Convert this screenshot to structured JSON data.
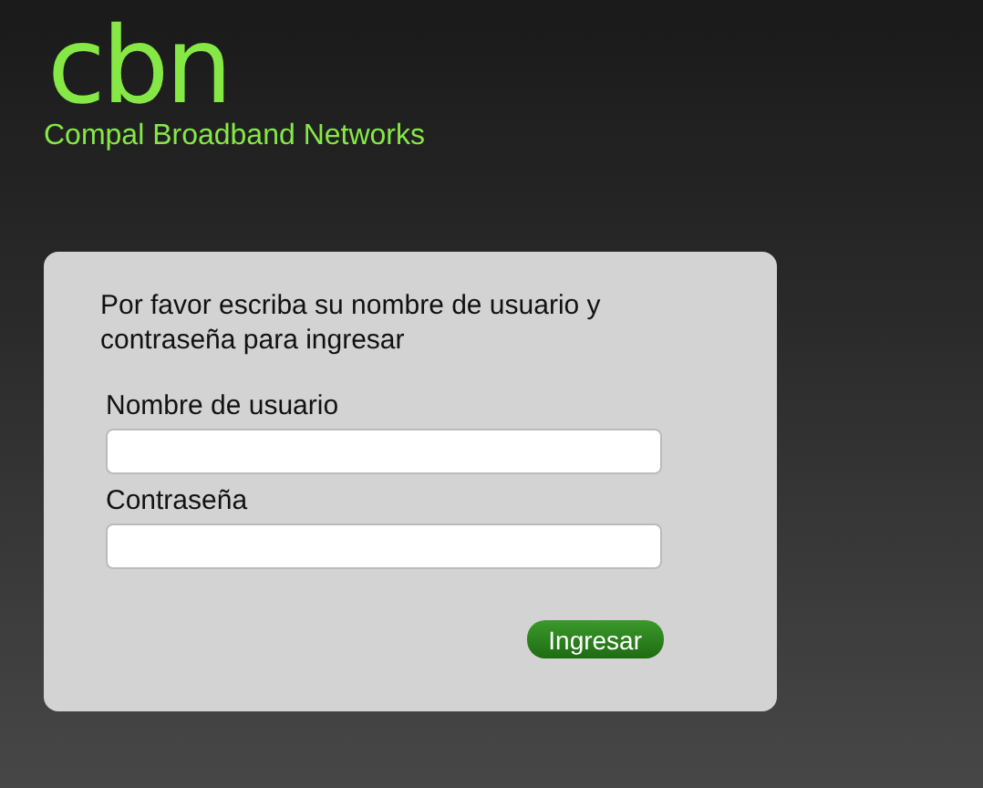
{
  "logo": {
    "mark": "cbn",
    "company": "Compal Broadband Networks"
  },
  "login": {
    "instructions": "Por favor escriba su nombre de usuario y contraseña para ingresar",
    "fields": [
      {
        "label": "Nombre de usuario"
      },
      {
        "label": "Contraseña"
      }
    ],
    "button": "Ingresar"
  }
}
